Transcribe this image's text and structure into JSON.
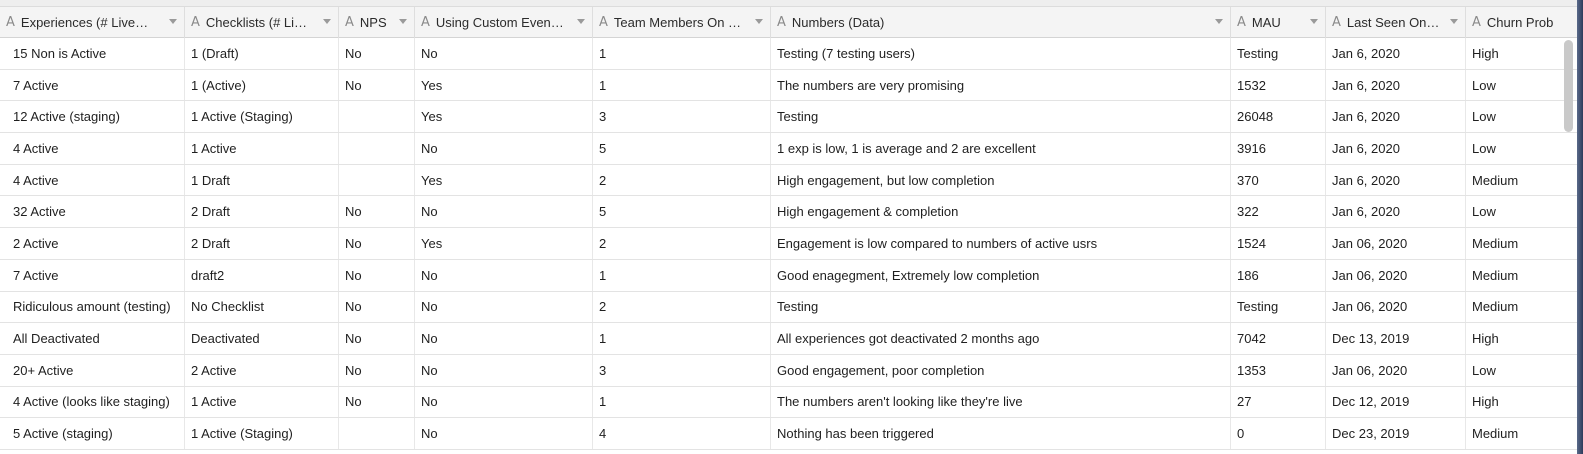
{
  "columns": [
    {
      "label": "Experiences (# Live…",
      "type_icon": "text-type-icon"
    },
    {
      "label": "Checklists (# Li…",
      "type_icon": "text-type-icon"
    },
    {
      "label": "NPS",
      "type_icon": "text-type-icon"
    },
    {
      "label": "Using Custom Even…",
      "type_icon": "text-type-icon"
    },
    {
      "label": "Team Members On …",
      "type_icon": "text-type-icon"
    },
    {
      "label": "Numbers (Data)",
      "type_icon": "text-type-icon"
    },
    {
      "label": "MAU",
      "type_icon": "text-type-icon"
    },
    {
      "label": "Last Seen On…",
      "type_icon": "text-type-icon"
    },
    {
      "label": "Churn Prob",
      "type_icon": "text-type-icon"
    }
  ],
  "type_glyph": "A",
  "rows": [
    [
      "15 Non is Active",
      "1 (Draft)",
      "No",
      "No",
      "1",
      "Testing (7 testing users)",
      "Testing",
      "Jan 6, 2020",
      "High"
    ],
    [
      "7 Active",
      "1 (Active)",
      "No",
      "Yes",
      "1",
      "The numbers are very promising",
      "1532",
      "Jan 6, 2020",
      "Low"
    ],
    [
      "12 Active (staging)",
      "1 Active (Staging)",
      "",
      "Yes",
      "3",
      "Testing",
      "26048",
      "Jan 6, 2020",
      "Low"
    ],
    [
      "4 Active",
      "1 Active",
      "",
      "No",
      "5",
      "1 exp is low, 1 is average and 2 are excellent",
      "3916",
      "Jan 6, 2020",
      "Low"
    ],
    [
      "4 Active",
      "1 Draft",
      "",
      "Yes",
      "2",
      "High engagement, but low completion",
      "370",
      "Jan 6, 2020",
      "Medium"
    ],
    [
      "32 Active",
      "2 Draft",
      "No",
      "No",
      "5",
      "High engagement & completion",
      "322",
      "Jan 6, 2020",
      "Low"
    ],
    [
      "2 Active",
      "2 Draft",
      "No",
      "Yes",
      "2",
      "Engagement is low compared to numbers of active usrs",
      "1524",
      "Jan 06, 2020",
      "Medium"
    ],
    [
      "7 Active",
      "draft2",
      "No",
      "No",
      "1",
      "Good enagegment, Extremely low completion",
      "186",
      "Jan 06, 2020",
      "Medium"
    ],
    [
      "Ridiculous amount (testing)",
      "No Checklist",
      "No",
      "No",
      "2",
      "Testing",
      "Testing",
      "Jan 06, 2020",
      "Medium"
    ],
    [
      "All Deactivated",
      "Deactivated",
      "No",
      "No",
      "1",
      "All experiences got deactivated 2 months ago",
      "7042",
      "Dec 13, 2019",
      "High"
    ],
    [
      "20+ Active",
      "2 Active",
      "No",
      "No",
      "3",
      "Good engagement, poor completion",
      "1353",
      "Jan 06, 2020",
      "Low"
    ],
    [
      "4 Active (looks like staging)",
      "1 Active",
      "No",
      "No",
      "1",
      "The numbers aren't looking like they're live",
      "27",
      "Dec 12, 2019",
      "High"
    ],
    [
      "5 Active (staging)",
      "1 Active (Staging)",
      "",
      "No",
      "4",
      "Nothing has been triggered",
      "0",
      "Dec 23, 2019",
      "Medium"
    ]
  ],
  "colors": {
    "header_bg": "#f4f4f4",
    "grid_line": "#e3e3e3",
    "text": "#1f1f1f",
    "icon": "#8a8a8a"
  }
}
